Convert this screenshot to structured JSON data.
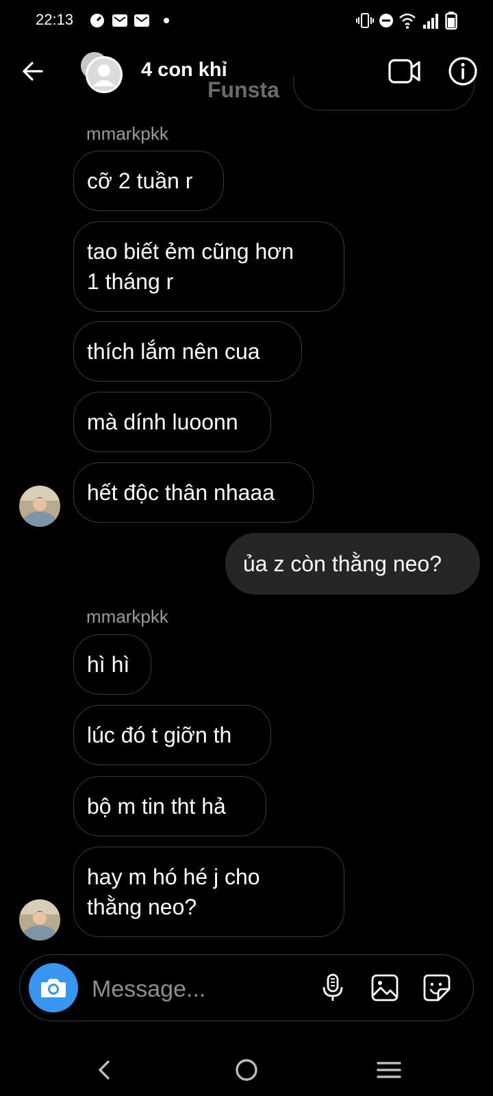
{
  "status_bar": {
    "time": "22:13",
    "left_icons": [
      "speed-icon",
      "mail-icon",
      "mail-icon",
      "dot-icon"
    ],
    "right_icons": [
      "vibrate-icon",
      "dnd-icon",
      "wifi-icon",
      "signal-icon",
      "battery-icon"
    ]
  },
  "header": {
    "title": "4 con khỉ",
    "overlay_text": "Funsta",
    "back_icon": "arrow-left-icon",
    "video_icon": "video-camera-icon",
    "info_icon": "info-icon"
  },
  "messages": [
    {
      "sender": "mmarkpkk"
    },
    {
      "text": "cỡ 2 tuần r"
    },
    {
      "text": "tao biết ẻm cũng hơn\n1 tháng r"
    },
    {
      "text": "thích lắm nên cua"
    },
    {
      "text": "mà dính luoonn"
    },
    {
      "text": "hết độc thân nhaaa"
    },
    {
      "text": "ủa z còn thằng neo?",
      "outgoing": true
    },
    {
      "sender": "mmarkpkk"
    },
    {
      "text": "hì hì"
    },
    {
      "text": "lúc đó t giỡn th"
    },
    {
      "text": "bộ m tin tht hả"
    },
    {
      "text": "hay m hó hé j cho\nthằng neo?"
    }
  ],
  "composer": {
    "placeholder": "Message...",
    "camera_icon": "camera-icon",
    "mic_icon": "microphone-icon",
    "gallery_icon": "image-icon",
    "sticker_icon": "sticker-icon",
    "accent_color": "#3797f0"
  },
  "nav_bar": {
    "icons": [
      "back-nav-icon",
      "home-nav-icon",
      "recents-nav-icon"
    ]
  }
}
